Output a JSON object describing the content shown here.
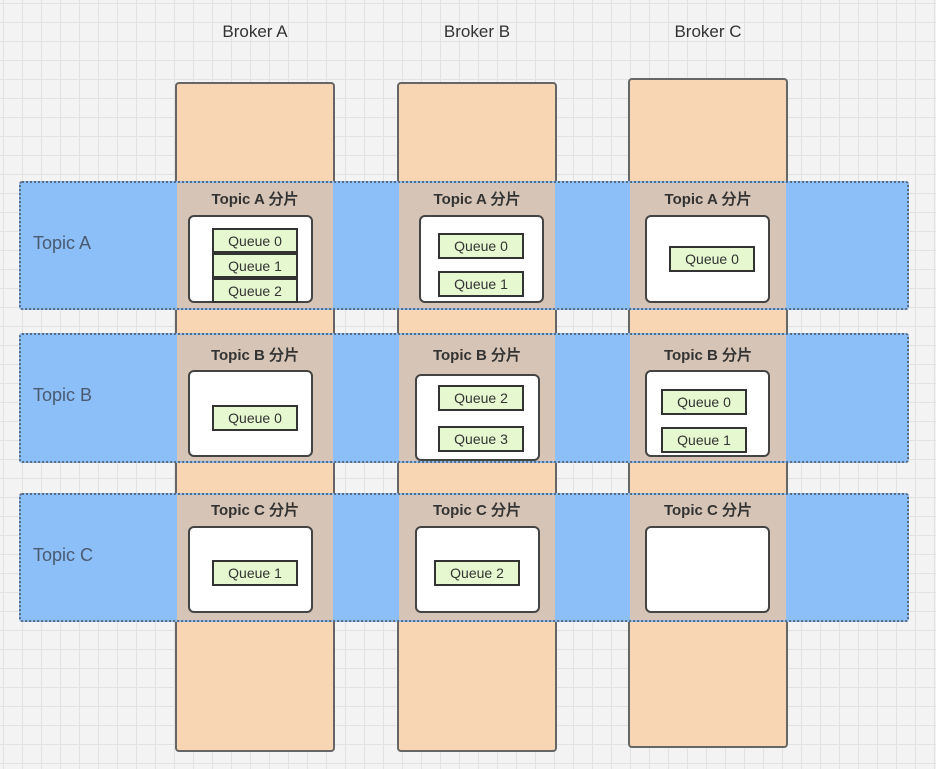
{
  "brokers": [
    {
      "title": "Broker A"
    },
    {
      "title": "Broker B"
    },
    {
      "title": "Broker C"
    }
  ],
  "topics": [
    {
      "label": "Topic A"
    },
    {
      "label": "Topic B"
    },
    {
      "label": "Topic C"
    }
  ],
  "cells": [
    [
      {
        "label": "Topic A 分片",
        "queues": [
          "Queue 0",
          "Queue 1",
          "Queue 2"
        ]
      },
      {
        "label": "Topic A 分片",
        "queues": [
          "Queue 0",
          "Queue 1"
        ]
      },
      {
        "label": "Topic A 分片",
        "queues": [
          "Queue 0"
        ]
      }
    ],
    [
      {
        "label": "Topic B 分片",
        "queues": [
          "Queue 0"
        ]
      },
      {
        "label": "Topic B 分片",
        "queues": [
          "Queue 2",
          "Queue 3"
        ]
      },
      {
        "label": "Topic B 分片",
        "queues": [
          "Queue 0",
          "Queue 1"
        ]
      }
    ],
    [
      {
        "label": "Topic C 分片",
        "queues": [
          "Queue 1"
        ]
      },
      {
        "label": "Topic C 分片",
        "queues": [
          "Queue 2"
        ]
      },
      {
        "label": "Topic C 分片",
        "queues": []
      }
    ]
  ],
  "colors": {
    "broker": "#f8d5b3",
    "topic_row": "#8cbff7",
    "overlap": "#d6c5b6",
    "queue": "#e5f8cf"
  }
}
